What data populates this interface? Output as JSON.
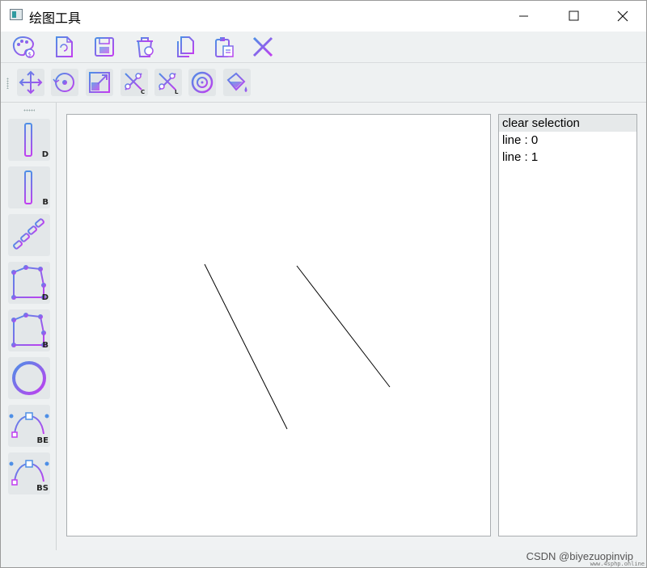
{
  "window": {
    "title": "绘图工具",
    "controls": [
      "minimize",
      "maximize",
      "close"
    ]
  },
  "toolbar_top": {
    "items": [
      {
        "name": "palette-icon"
      },
      {
        "name": "new-file-icon"
      },
      {
        "name": "save-icon"
      },
      {
        "name": "trash-icon"
      },
      {
        "name": "copy-icon"
      },
      {
        "name": "paste-icon"
      },
      {
        "name": "close-x-icon"
      }
    ]
  },
  "toolbar_edit": {
    "items": [
      {
        "name": "move-icon"
      },
      {
        "name": "rotate-icon"
      },
      {
        "name": "scale-icon"
      },
      {
        "name": "clip-c-icon",
        "sub": "C"
      },
      {
        "name": "clip-l-icon",
        "sub": "L"
      },
      {
        "name": "circle-target-icon"
      },
      {
        "name": "fill-bucket-icon"
      }
    ]
  },
  "left_tools": [
    {
      "name": "line-dda-tool",
      "sub": "D"
    },
    {
      "name": "line-bresenham-tool",
      "sub": "B"
    },
    {
      "name": "line-chain-tool",
      "sub": ""
    },
    {
      "name": "polygon-dda-tool",
      "sub": "D"
    },
    {
      "name": "polygon-bresenham-tool",
      "sub": "B"
    },
    {
      "name": "ellipse-tool",
      "sub": ""
    },
    {
      "name": "curve-bezier-tool",
      "sub": "BE"
    },
    {
      "name": "curve-bspline-tool",
      "sub": "BS"
    }
  ],
  "list": {
    "items": [
      "clear selection",
      "line : 0",
      "line : 1"
    ],
    "selected_index": 0
  },
  "watermark": "CSDN @biyezuopinvip",
  "watermark_small": "www.4sphp.online",
  "colors": {
    "icon_grad_start": "#4e8fe6",
    "icon_grad_end": "#c13ef0"
  }
}
